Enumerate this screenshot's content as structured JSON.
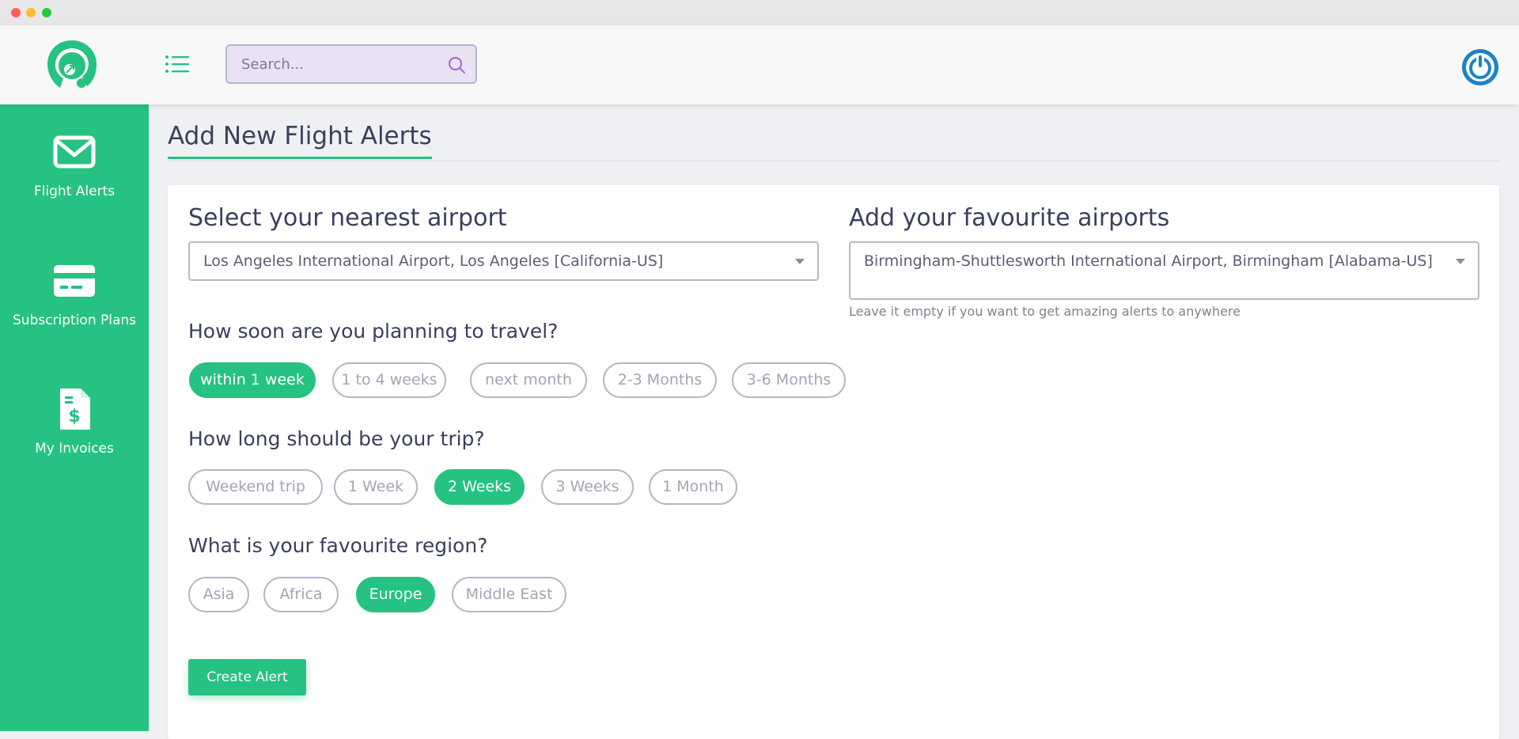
{
  "colors": {
    "accent": "#25c281",
    "power": "#1a84c6",
    "text": "#3a3f5c"
  },
  "header": {
    "logo_icon": "plane-logo-icon",
    "menu_icon": "list-menu-icon",
    "search": {
      "placeholder": "Search...",
      "icon": "search-icon"
    },
    "power_icon": "power-icon"
  },
  "sidebar": {
    "items": [
      {
        "label": "Flight Alerts",
        "icon": "envelope-icon"
      },
      {
        "label": "Subscription Plans",
        "icon": "credit-card-icon"
      },
      {
        "label": "My Invoices",
        "icon": "invoice-dollar-icon"
      }
    ]
  },
  "page": {
    "title": "Add New Flight Alerts"
  },
  "form": {
    "nearest_airport": {
      "heading": "Select your nearest airport",
      "value": "Los Angeles International Airport, Los Angeles [California-US]"
    },
    "favourite_airports": {
      "heading": "Add your favourite airports",
      "value": "Birmingham-Shuttlesworth International Airport, Birmingham [Alabama-US]",
      "helper": "Leave it empty if you want to get amazing alerts to anywhere"
    },
    "travel_when": {
      "question": "How soon are you planning to travel?",
      "options": [
        "within 1 week",
        "1 to 4 weeks",
        "next month",
        "2-3 Months",
        "3-6 Months"
      ],
      "selected": "within 1 week"
    },
    "trip_length": {
      "question": "How long should be your trip?",
      "options": [
        "Weekend trip",
        "1 Week",
        "2 Weeks",
        "3 Weeks",
        "1 Month"
      ],
      "selected": "2 Weeks"
    },
    "region": {
      "question": "What is your favourite region?",
      "options": [
        "Asia",
        "Africa",
        "Europe",
        "Middle East"
      ],
      "selected": "Europe"
    },
    "submit_label": "Create Alert"
  }
}
